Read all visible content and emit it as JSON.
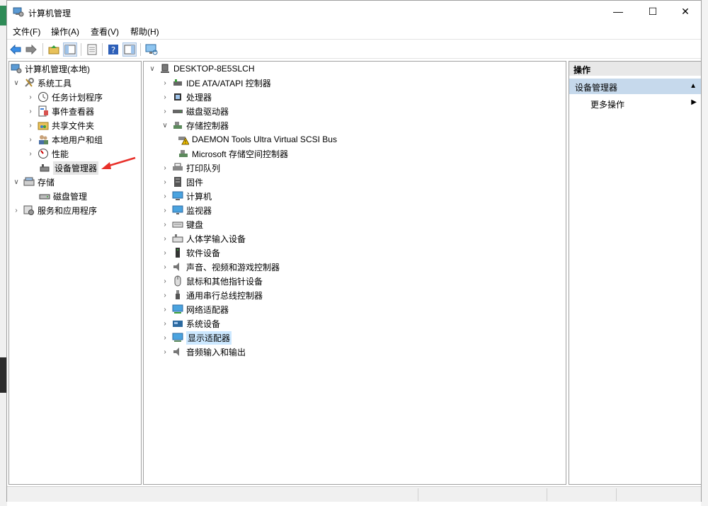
{
  "window": {
    "title": "计算机管理"
  },
  "window_buttons": {
    "minimize": "—",
    "maximize": "☐",
    "close": "✕"
  },
  "menu": [
    "文件(F)",
    "操作(A)",
    "查看(V)",
    "帮助(H)"
  ],
  "left_tree": [
    {
      "label": "计算机管理(本地)",
      "icon": "computer-management-icon"
    },
    {
      "label": "系统工具",
      "icon": "tools-icon"
    },
    {
      "label": "任务计划程序",
      "icon": "clock-icon"
    },
    {
      "label": "事件查看器",
      "icon": "event-viewer-icon"
    },
    {
      "label": "共享文件夹",
      "icon": "shared-folder-icon"
    },
    {
      "label": "本地用户和组",
      "icon": "users-icon"
    },
    {
      "label": "性能",
      "icon": "performance-icon"
    },
    {
      "label": "设备管理器",
      "icon": "device-manager-icon"
    },
    {
      "label": "存储",
      "icon": "storage-icon"
    },
    {
      "label": "磁盘管理",
      "icon": "disk-icon"
    },
    {
      "label": "服务和应用程序",
      "icon": "services-icon"
    }
  ],
  "device_tree": {
    "root": "DESKTOP-8E5SLCH",
    "items": [
      {
        "label": "IDE ATA/ATAPI 控制器",
        "icon": "ide-icon"
      },
      {
        "label": "处理器",
        "icon": "cpu-icon"
      },
      {
        "label": "磁盘驱动器",
        "icon": "disk-drive-icon"
      },
      {
        "label": "存储控制器",
        "icon": "storage-controller-icon"
      },
      {
        "label": "DAEMON Tools Ultra Virtual SCSI Bus",
        "icon": "warning-device-icon"
      },
      {
        "label": "Microsoft 存储空间控制器",
        "icon": "storage-controller-icon"
      },
      {
        "label": "打印队列",
        "icon": "printer-icon"
      },
      {
        "label": "固件",
        "icon": "firmware-icon"
      },
      {
        "label": "计算机",
        "icon": "computer-icon"
      },
      {
        "label": "监视器",
        "icon": "monitor-icon"
      },
      {
        "label": "键盘",
        "icon": "keyboard-icon"
      },
      {
        "label": "人体学输入设备",
        "icon": "hid-icon"
      },
      {
        "label": "软件设备",
        "icon": "software-device-icon"
      },
      {
        "label": "声音、视频和游戏控制器",
        "icon": "speaker-icon"
      },
      {
        "label": "鼠标和其他指针设备",
        "icon": "mouse-icon"
      },
      {
        "label": "通用串行总线控制器",
        "icon": "usb-icon"
      },
      {
        "label": "网络适配器",
        "icon": "network-icon"
      },
      {
        "label": "系统设备",
        "icon": "system-device-icon"
      },
      {
        "label": "显示适配器",
        "icon": "display-adapter-icon"
      },
      {
        "label": "音频输入和输出",
        "icon": "audio-icon"
      }
    ]
  },
  "actions": {
    "header": "操作",
    "section": "设备管理器",
    "more": "更多操作"
  },
  "colors": {
    "selection_blue": "#cce8ff",
    "action_section": "#c6d9ec",
    "arrow_red": "#e8302a"
  }
}
